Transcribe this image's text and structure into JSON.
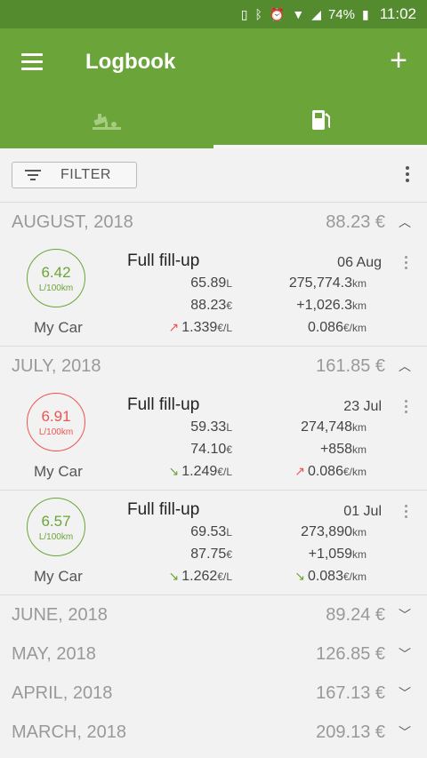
{
  "status": {
    "battery": "74%",
    "time": "11:02"
  },
  "appbar": {
    "title": "Logbook"
  },
  "filter": {
    "label": "FILTER"
  },
  "colors": {
    "primary": "#6ba539",
    "primary_dark": "#558b2f",
    "increase": "#ef5350",
    "decrease": "#6ba539"
  },
  "months": [
    {
      "name": "AUGUST, 2018",
      "total": "88.23 €",
      "expanded": true,
      "entries": [
        {
          "circle_value": "6.42",
          "circle_unit": "L/100km",
          "circle_color": "green",
          "car": "My Car",
          "type": "Full fill-up",
          "date": "06 Aug",
          "volume": "65.89",
          "volume_unit": "L",
          "odometer": "275,774.3",
          "odometer_unit": "km",
          "cost": "88.23",
          "cost_unit": "€",
          "distance": "+1,026.3",
          "distance_unit": "km",
          "price": "1.339",
          "price_unit": "€/L",
          "price_trend": "up",
          "cost_per_km": "0.086",
          "cost_per_km_unit": "€/km",
          "cost_per_km_trend": "none"
        }
      ]
    },
    {
      "name": "JULY, 2018",
      "total": "161.85 €",
      "expanded": true,
      "entries": [
        {
          "circle_value": "6.91",
          "circle_unit": "L/100km",
          "circle_color": "red",
          "car": "My Car",
          "type": "Full fill-up",
          "date": "23 Jul",
          "volume": "59.33",
          "volume_unit": "L",
          "odometer": "274,748",
          "odometer_unit": "km",
          "cost": "74.10",
          "cost_unit": "€",
          "distance": "+858",
          "distance_unit": "km",
          "price": "1.249",
          "price_unit": "€/L",
          "price_trend": "down",
          "cost_per_km": "0.086",
          "cost_per_km_unit": "€/km",
          "cost_per_km_trend": "up"
        },
        {
          "circle_value": "6.57",
          "circle_unit": "L/100km",
          "circle_color": "green",
          "car": "My Car",
          "type": "Full fill-up",
          "date": "01 Jul",
          "volume": "69.53",
          "volume_unit": "L",
          "odometer": "273,890",
          "odometer_unit": "km",
          "cost": "87.75",
          "cost_unit": "€",
          "distance": "+1,059",
          "distance_unit": "km",
          "price": "1.262",
          "price_unit": "€/L",
          "price_trend": "down",
          "cost_per_km": "0.083",
          "cost_per_km_unit": "€/km",
          "cost_per_km_trend": "down"
        }
      ]
    },
    {
      "name": "JUNE, 2018",
      "total": "89.24 €",
      "expanded": false,
      "entries": []
    },
    {
      "name": "MAY, 2018",
      "total": "126.85 €",
      "expanded": false,
      "entries": []
    },
    {
      "name": "APRIL, 2018",
      "total": "167.13 €",
      "expanded": false,
      "entries": []
    },
    {
      "name": "MARCH, 2018",
      "total": "209.13 €",
      "expanded": false,
      "entries": []
    }
  ]
}
